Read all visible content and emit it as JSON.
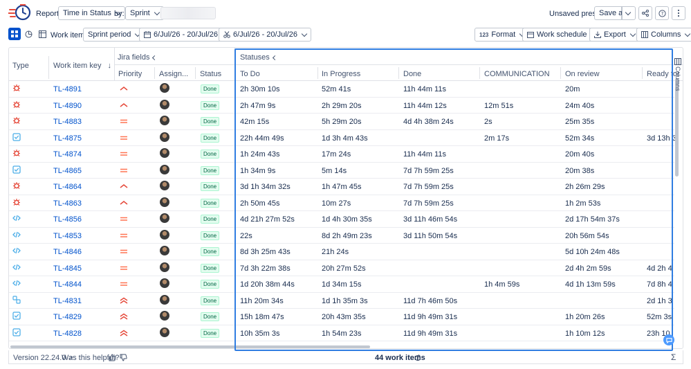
{
  "topbar": {
    "report_label": "Report:",
    "report_value": "Time in Status",
    "by_label": "by:",
    "by_value": "Sprint",
    "unsaved_preset": "Unsaved preset",
    "save_as": "Save as"
  },
  "toolbar": {
    "work_items_label": "Work items:",
    "sprint_period": "Sprint period",
    "date_range_1": "6/Jul/26 - 20/Jul/26",
    "date_range_2": "6/Jul/26 - 20/Jul/26",
    "format": "Format",
    "format_prefix": "123",
    "work_schedule": "Work schedule",
    "export": "Export",
    "columns": "Columns"
  },
  "table": {
    "group_jira_fields": "Jira fields",
    "group_statuses": "Statuses",
    "col_type": "Type",
    "col_key": "Work item key",
    "col_priority": "Priority",
    "col_assignee": "Assign...",
    "col_status": "Status",
    "status_columns": [
      "To Do",
      "In Progress",
      "Done",
      "COMMUNICATION",
      "On review",
      "Ready for"
    ],
    "side_columns_label": "Columns",
    "rows": [
      {
        "type": "bug",
        "key": "TL-4891",
        "priority": "high",
        "status": "Done",
        "todo": "2h 30m 10s",
        "inprogress": "52m 41s",
        "done": "11h 44m 11s",
        "comm": "",
        "review": "20m",
        "ready": ""
      },
      {
        "type": "bug",
        "key": "TL-4890",
        "priority": "high",
        "status": "Done",
        "todo": "2h 47m 9s",
        "inprogress": "2h 29m 20s",
        "done": "11h 44m 12s",
        "comm": "12m 51s",
        "review": "24m 40s",
        "ready": ""
      },
      {
        "type": "bug",
        "key": "TL-4883",
        "priority": "medium",
        "status": "Done",
        "todo": "42m 15s",
        "inprogress": "5h 29m 20s",
        "done": "4d 4h 38m 24s",
        "comm": "2s",
        "review": "25m 35s",
        "ready": ""
      },
      {
        "type": "task",
        "key": "TL-4875",
        "priority": "medium",
        "status": "Done",
        "todo": "22h 44m 49s",
        "inprogress": "1d 3h 4m 43s",
        "done": "",
        "comm": "2m 17s",
        "review": "52m 34s",
        "ready": "3d 13h 3"
      },
      {
        "type": "bug",
        "key": "TL-4874",
        "priority": "medium",
        "status": "Done",
        "todo": "1h 24m 43s",
        "inprogress": "17m 24s",
        "done": "11h 44m 11s",
        "comm": "",
        "review": "20m 40s",
        "ready": ""
      },
      {
        "type": "task",
        "key": "TL-4865",
        "priority": "medium",
        "status": "Done",
        "todo": "1h 34m 9s",
        "inprogress": "5m 14s",
        "done": "7d 7h 59m 25s",
        "comm": "",
        "review": "20m 38s",
        "ready": ""
      },
      {
        "type": "bug",
        "key": "TL-4864",
        "priority": "high",
        "status": "Done",
        "todo": "3d 1h 34m 32s",
        "inprogress": "1h 47m 45s",
        "done": "7d 7h 59m 25s",
        "comm": "",
        "review": "2h 26m 29s",
        "ready": ""
      },
      {
        "type": "bug",
        "key": "TL-4863",
        "priority": "high",
        "status": "Done",
        "todo": "2h 50m 45s",
        "inprogress": "10m 27s",
        "done": "7d 7h 59m 25s",
        "comm": "",
        "review": "1h 2m 53s",
        "ready": ""
      },
      {
        "type": "code",
        "key": "TL-4856",
        "priority": "medium",
        "status": "Done",
        "todo": "4d 21h 27m 52s",
        "inprogress": "1d 4h 30m 35s",
        "done": "3d 11h 46m 54s",
        "comm": "",
        "review": "2d 17h 54m 37s",
        "ready": ""
      },
      {
        "type": "code",
        "key": "TL-4853",
        "priority": "medium",
        "status": "Done",
        "todo": "22s",
        "inprogress": "8d 2h 49m 23s",
        "done": "3d 11h 50m 54s",
        "comm": "",
        "review": "20h 56m 54s",
        "ready": ""
      },
      {
        "type": "code",
        "key": "TL-4846",
        "priority": "medium",
        "status": "Done",
        "todo": "8d 3h 25m 43s",
        "inprogress": "21h 24s",
        "done": "",
        "comm": "",
        "review": "5d 10h 24m 48s",
        "ready": ""
      },
      {
        "type": "code",
        "key": "TL-4845",
        "priority": "medium",
        "status": "Done",
        "todo": "7d 3h 22m 38s",
        "inprogress": "20h 27m 52s",
        "done": "",
        "comm": "",
        "review": "2d 4h 2m 59s",
        "ready": "4d 2h 4"
      },
      {
        "type": "code",
        "key": "TL-4844",
        "priority": "medium",
        "status": "Done",
        "todo": "1d 20h 38m 44s",
        "inprogress": "1d 34m 15s",
        "done": "",
        "comm": "1h 4m 59s",
        "review": "4d 1h 13m 59s",
        "ready": "7d 8h 4"
      },
      {
        "type": "subtask",
        "key": "TL-4831",
        "priority": "highest",
        "status": "Done",
        "todo": "11h 20m 34s",
        "inprogress": "1d 1h 35m 3s",
        "done": "11d 7h 46m 50s",
        "comm": "",
        "review": "",
        "ready": "2d 1h 3"
      },
      {
        "type": "task",
        "key": "TL-4829",
        "priority": "highest",
        "status": "Done",
        "todo": "15h 18m 47s",
        "inprogress": "20h 43m 35s",
        "done": "11d 9h 49m 31s",
        "comm": "",
        "review": "1h 20m 26s",
        "ready": "52m 3s"
      },
      {
        "type": "task",
        "key": "TL-4828",
        "priority": "highest",
        "status": "Done",
        "todo": "10h 35m 3s",
        "inprogress": "1h 54m 23s",
        "done": "11d 9h 49m 31s",
        "comm": "",
        "review": "1h 10m 12s",
        "ready": "23h 10"
      }
    ]
  },
  "footer": {
    "version": "Version 22.24.0",
    "helpful": "Was this helpful?",
    "count": "44 work items"
  },
  "colors": {
    "accent": "#0052cc",
    "selection": "#2f7de1",
    "bug": "#e5493a",
    "task": "#4bade8",
    "priority_high": "#e5493a",
    "priority_medium": "#ff7452",
    "done_bg": "#e3fcef",
    "done_fg": "#006644"
  }
}
